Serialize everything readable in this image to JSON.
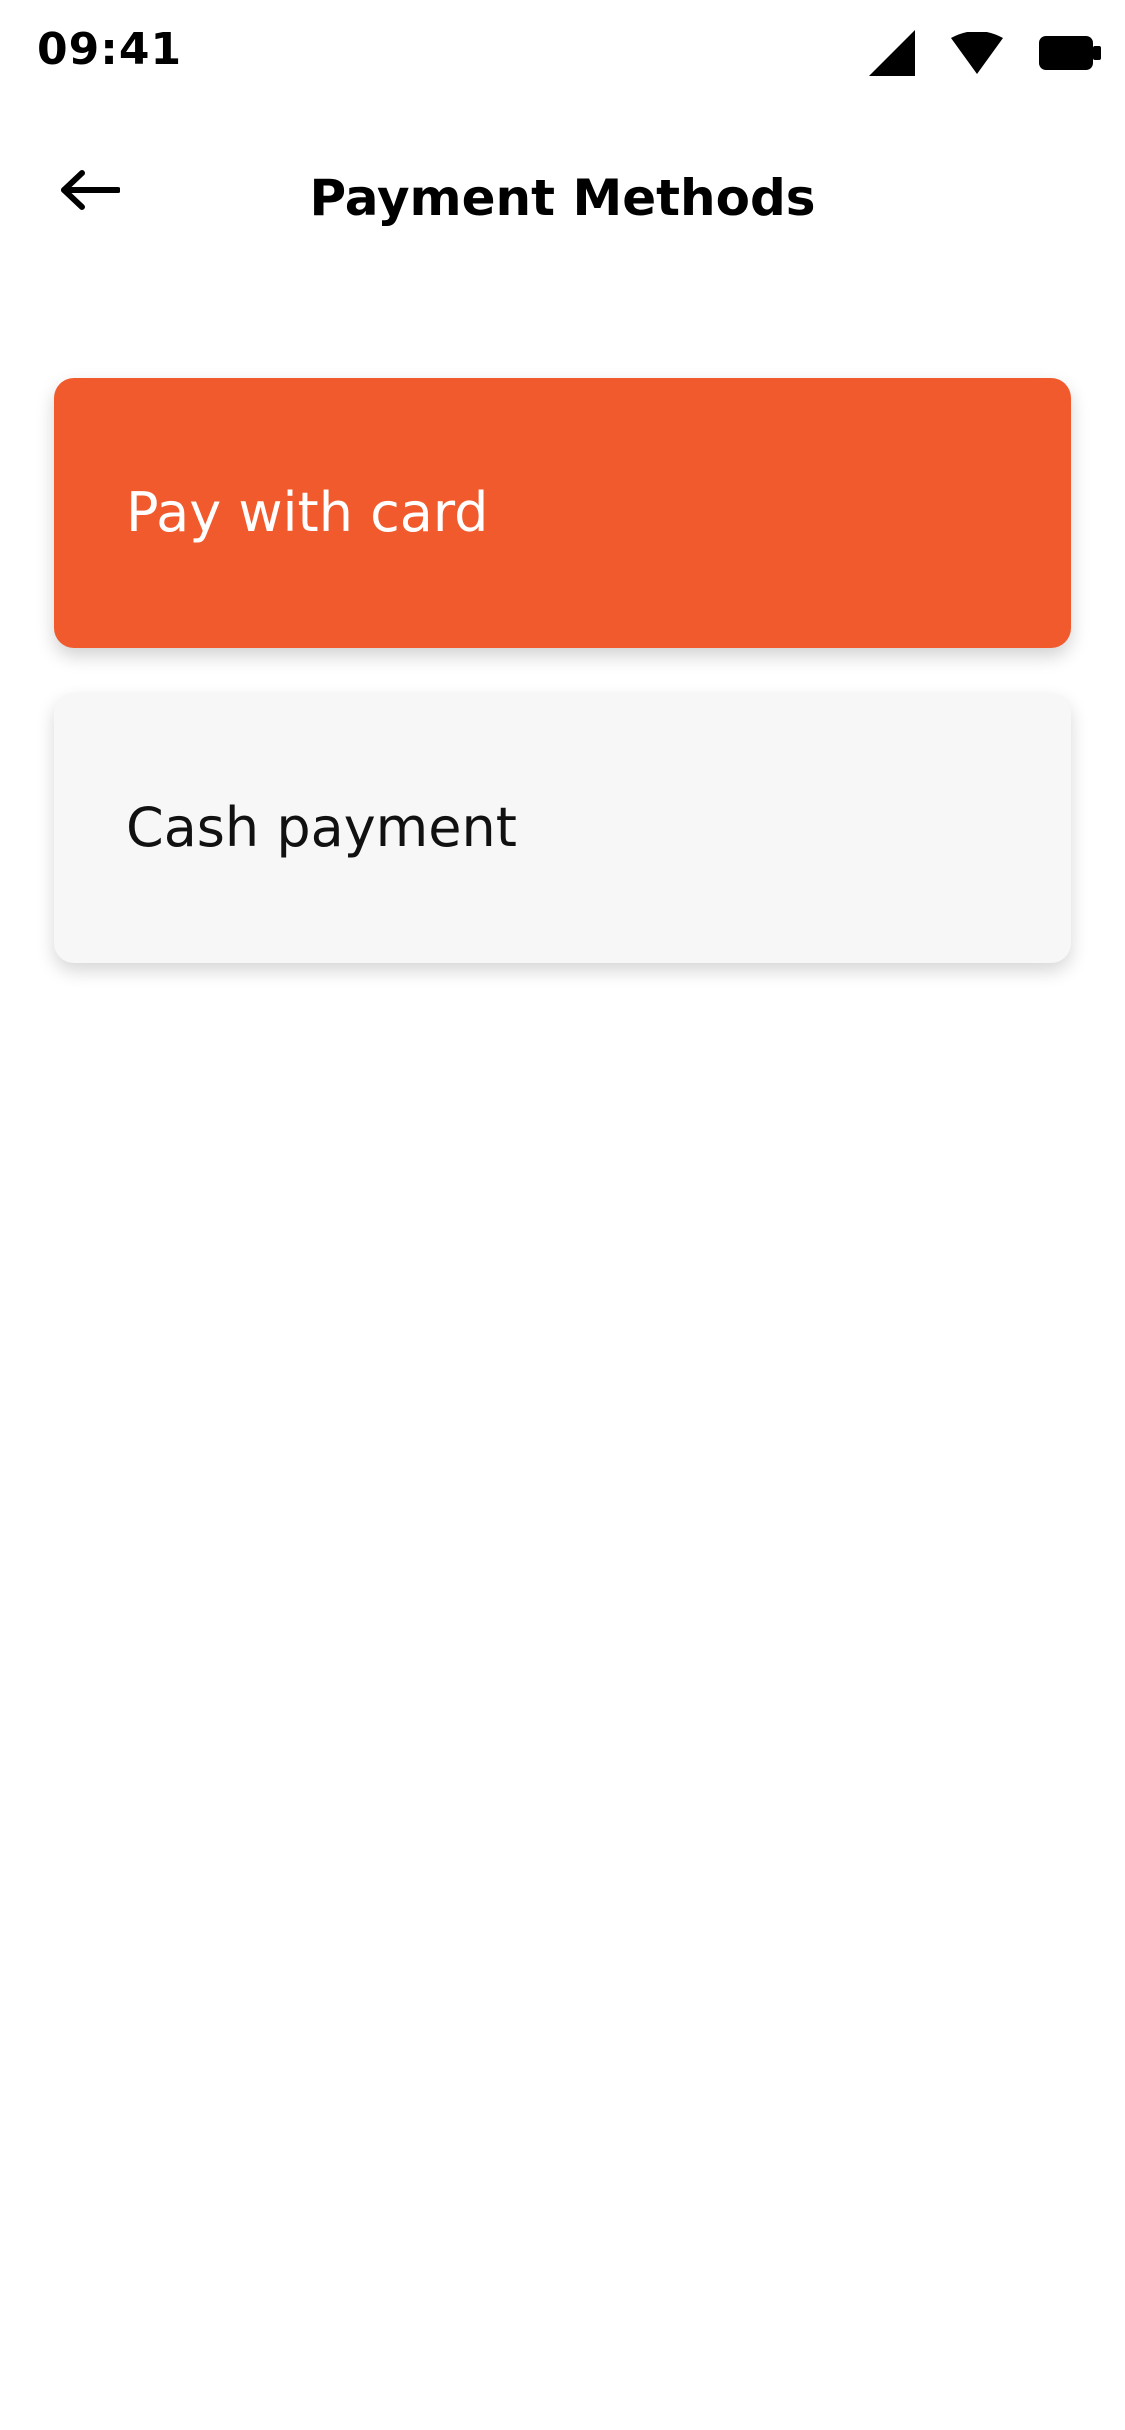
{
  "status_bar": {
    "time": "09:41",
    "icons": [
      "signal-icon",
      "wifi-icon",
      "battery-icon"
    ]
  },
  "app_bar": {
    "back_icon": "arrow-left-icon",
    "title": "Payment Methods"
  },
  "options": [
    {
      "label": "Pay with card",
      "selected": true,
      "color": "#f15a2d"
    },
    {
      "label": "Cash payment",
      "selected": false,
      "color": "#f7f7f7"
    }
  ]
}
